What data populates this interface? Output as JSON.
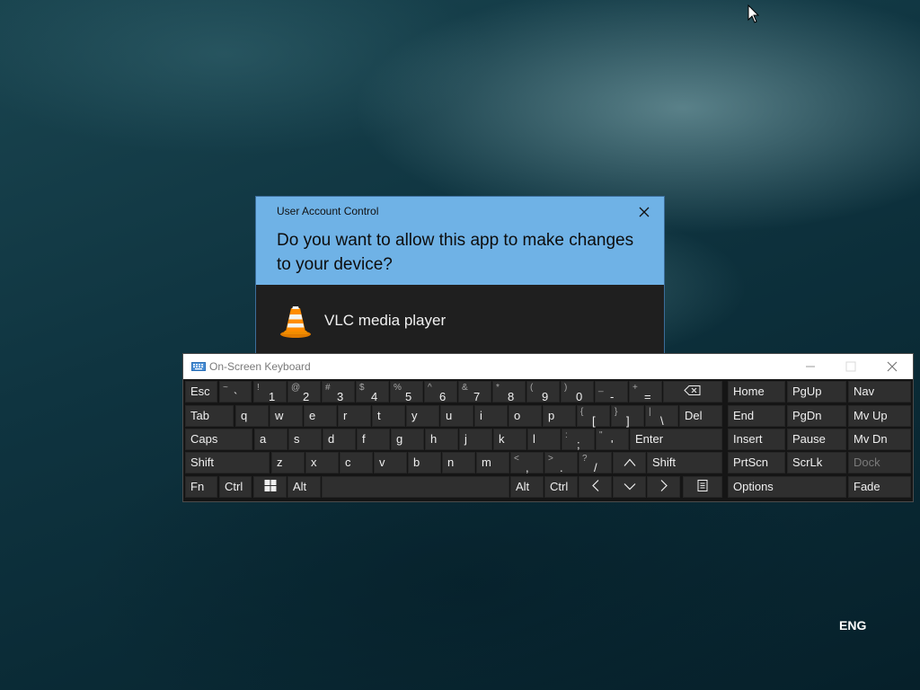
{
  "uac": {
    "title": "User Account Control",
    "question": "Do you want to allow this app to make changes to your device?",
    "app_name": "VLC media player",
    "header_color": "#6fb2e6"
  },
  "osk": {
    "title": "On-Screen Keyboard",
    "rows": [
      [
        {
          "label": "Esc"
        },
        {
          "shift": "~",
          "base": "`"
        },
        {
          "shift": "!",
          "base": "1"
        },
        {
          "shift": "@",
          "base": "2"
        },
        {
          "shift": "#",
          "base": "3"
        },
        {
          "shift": "$",
          "base": "4"
        },
        {
          "shift": "%",
          "base": "5"
        },
        {
          "shift": "^",
          "base": "6"
        },
        {
          "shift": "&",
          "base": "7"
        },
        {
          "shift": "*",
          "base": "8"
        },
        {
          "shift": "(",
          "base": "9"
        },
        {
          "shift": ")",
          "base": "0"
        },
        {
          "shift": "_",
          "base": "-"
        },
        {
          "shift": "+",
          "base": "="
        },
        {
          "icon": "backspace-icon"
        }
      ],
      [
        {
          "label": "Tab"
        },
        {
          "label": "q"
        },
        {
          "label": "w"
        },
        {
          "label": "e"
        },
        {
          "label": "r"
        },
        {
          "label": "t"
        },
        {
          "label": "y"
        },
        {
          "label": "u"
        },
        {
          "label": "i"
        },
        {
          "label": "o"
        },
        {
          "label": "p"
        },
        {
          "shift": "{",
          "base": "["
        },
        {
          "shift": "}",
          "base": "]"
        },
        {
          "shift": "|",
          "base": "\\"
        },
        {
          "label": "Del"
        }
      ],
      [
        {
          "label": "Caps"
        },
        {
          "label": "a"
        },
        {
          "label": "s"
        },
        {
          "label": "d"
        },
        {
          "label": "f"
        },
        {
          "label": "g"
        },
        {
          "label": "h"
        },
        {
          "label": "j"
        },
        {
          "label": "k"
        },
        {
          "label": "l"
        },
        {
          "shift": ":",
          "base": ";"
        },
        {
          "shift": "\"",
          "base": "'"
        },
        {
          "label": "Enter"
        }
      ],
      [
        {
          "label": "Shift"
        },
        {
          "label": "z"
        },
        {
          "label": "x"
        },
        {
          "label": "c"
        },
        {
          "label": "v"
        },
        {
          "label": "b"
        },
        {
          "label": "n"
        },
        {
          "label": "m"
        },
        {
          "shift": "<",
          "base": ","
        },
        {
          "shift": ">",
          "base": "."
        },
        {
          "shift": "?",
          "base": "/"
        },
        {
          "icon": "arrow-up-icon"
        },
        {
          "label": "Shift"
        }
      ],
      [
        {
          "label": "Fn"
        },
        {
          "label": "Ctrl"
        },
        {
          "icon": "windows-icon"
        },
        {
          "label": "Alt"
        },
        {
          "label": ""
        },
        {
          "label": "Alt"
        },
        {
          "label": "Ctrl"
        },
        {
          "icon": "arrow-left-icon"
        },
        {
          "icon": "arrow-down-icon"
        },
        {
          "icon": "arrow-right-icon"
        },
        {
          "icon": "context-menu-icon"
        }
      ]
    ],
    "side_keys": [
      [
        "Home",
        "PgUp",
        "Nav"
      ],
      [
        "End",
        "PgDn",
        "Mv Up"
      ],
      [
        "Insert",
        "Pause",
        "Mv Dn"
      ],
      [
        "PrtScn",
        "ScrLk",
        "Dock"
      ],
      [
        "Options",
        "Fade"
      ]
    ],
    "disabled_keys": [
      "Dock"
    ]
  },
  "taskbar": {
    "language": "ENG"
  }
}
